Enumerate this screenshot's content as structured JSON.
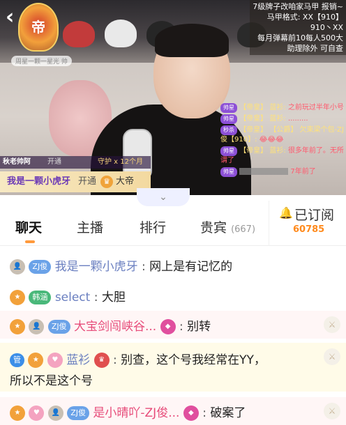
{
  "stream": {
    "back_icon": "chevron-left-icon",
    "rank_badge": "帝",
    "rank_caption": "周星一颗一星光 帅",
    "info_lines": [
      "7级牌子改咱家马甲 报销~",
      "马甲格式: XX【910】",
      "910丶XX",
      "每月弹幕前10每人500大",
      "助理除外  可自查"
    ],
    "anchor_name": "秋老帅阿",
    "anchor_action": "开通",
    "anchor_guard": "守护 x 12个月",
    "gift_user": "我是一颗小虎牙",
    "gift_action": "开通",
    "gift_rank": "大帝",
    "overlay_chat": [
      {
        "tag": "帅星",
        "name": "【帝皇】 蓝衫:",
        "text": "之前玩过半年小号"
      },
      {
        "tag": "帅星",
        "name": "【帝皇】 蓝衫:",
        "text": "........."
      },
      {
        "tag": "秒杀",
        "name": "【帝皇】 【公爵】 欠束梁个包-ZJ俊【910】:",
        "text": "😂😂😂"
      },
      {
        "tag": "帅星",
        "name": "【帝皇】 蓝衫:",
        "text": "很多年前了。无所谓了"
      },
      {
        "tag": "帅星",
        "name": "",
        "text": "7年前了"
      }
    ]
  },
  "tabs": [
    {
      "label": "聊天",
      "active": true
    },
    {
      "label": "主播",
      "active": false
    },
    {
      "label": "排行",
      "active": false
    },
    {
      "label": "贵宾",
      "count": "(667)",
      "active": false
    }
  ],
  "subscribe": {
    "label": "已订阅",
    "count": "60785",
    "icon": "bell-icon"
  },
  "chat": [
    {
      "badges": [
        "ZJ俊"
      ],
      "name": "我是一颗小虎牙",
      "text": "网上是有记忆的"
    },
    {
      "badges": [
        "韩涵"
      ],
      "name": "select",
      "text": "大胆"
    },
    {
      "badges": [
        "ZJ俊"
      ],
      "name": "大宝剑闯峡谷...",
      "text": "别转"
    },
    {
      "badges": [
        "管"
      ],
      "name": "蓝衫",
      "text": "别查，这个号我经常在YY，",
      "text2": "所以不是这个号"
    },
    {
      "badges": [
        "ZJ俊"
      ],
      "name": "是小晴吖-ZJ俊...",
      "text": "破案了"
    }
  ]
}
